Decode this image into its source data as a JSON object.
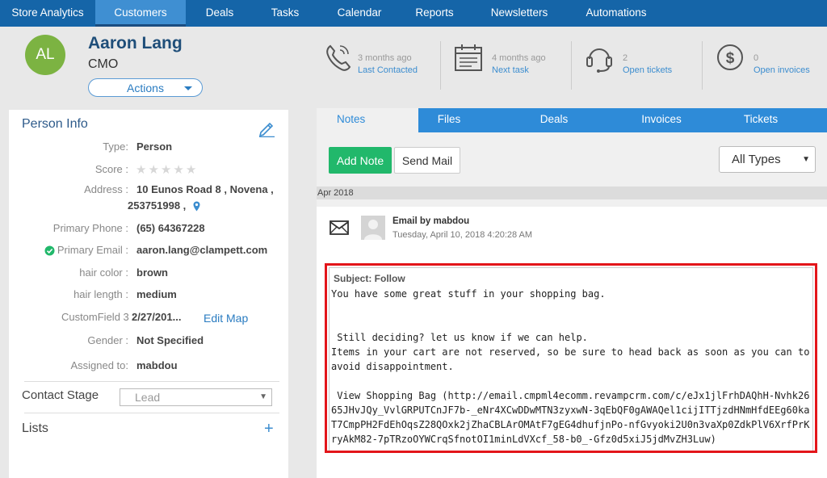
{
  "nav": {
    "items": [
      {
        "label": "Store Analytics",
        "width": 118
      },
      {
        "label": "Customers",
        "width": 112,
        "active": true
      },
      {
        "label": "Deals",
        "width": 84
      },
      {
        "label": "Tasks",
        "width": 78
      },
      {
        "label": "Calendar",
        "width": 106
      },
      {
        "label": "Reports",
        "width": 80
      },
      {
        "label": "Newsletters",
        "width": 130
      },
      {
        "label": "Automations",
        "width": 110
      }
    ]
  },
  "contact": {
    "initials": "AL",
    "name": "Aaron Lang",
    "title": "CMO",
    "actions_label": "Actions"
  },
  "stats": [
    {
      "top": "3 months ago",
      "bottom": "Last Contacted",
      "icon": "phone-icon"
    },
    {
      "top": "4 months ago",
      "bottom": "Next task",
      "icon": "calendar-icon"
    },
    {
      "top": "2",
      "bottom": "Open tickets",
      "icon": "headset-icon"
    },
    {
      "top": "0",
      "bottom": "Open invoices",
      "icon": "dollar-icon"
    }
  ],
  "person_info": {
    "title": "Person Info",
    "type_label": "Type:",
    "type_value": "Person",
    "score_label": "Score :",
    "address_label": "Address :",
    "address_line1": "10 Eunos Road 8 , Novena ,",
    "address_line2": "253751998 ,",
    "phone_label": "Primary Phone :",
    "phone_value": "(65) 64367228",
    "email_label": "Primary Email :",
    "email_value": "aaron.lang@clampett.com",
    "hair_color_label": "hair color :",
    "hair_color_value": "brown",
    "hair_length_label": "hair length :",
    "hair_length_value": "medium",
    "custom_label": "CustomField 3 :",
    "custom_value": "2/27/201...",
    "edit_map": "Edit Map",
    "gender_label": "Gender :",
    "gender_value": "Not Specified",
    "assigned_label": "Assigned to:",
    "assigned_value": "mabdou",
    "contact_stage_label": "Contact Stage",
    "contact_stage_value": "Lead",
    "lists_label": "Lists",
    "lists_plus": "+"
  },
  "tabs": {
    "items": [
      {
        "label": "Notes",
        "width": 126,
        "active": true
      },
      {
        "label": "Files",
        "width": 76
      },
      {
        "label": "Deals",
        "width": 184
      },
      {
        "label": "Invoices",
        "width": 82
      },
      {
        "label": "Tickets",
        "width": 164
      }
    ]
  },
  "notes": {
    "add_note": "Add Note",
    "send_mail": "Send Mail",
    "filter_value": "All Types",
    "date_group": "Apr 2018",
    "note_from": "Email by mabdou",
    "note_date": "Tuesday, April 10, 2018 4:20:28 AM",
    "subject": "Subject: Follow",
    "body_lines": [
      "You have some great stuff in your shopping bag.",
      "",
      "",
      " Still deciding? let us know if we can help.",
      "Items in your cart are not reserved, so be sure to head back as soon as you can to avoid disappointment.",
      "",
      " View Shopping Bag (http://email.cmpml4ecomm.revampcrm.com/c/eJx1jlFrhDAQhH-Nvhk2665JHvJQy_VvlGRPUTCnJF7b-_eNr4XCwDDwMTN3zyxwN-3qEbQF0gAWAQel1cijITTjzdHNmHfdEEg60kaT7CmpPH2FdEhOqsZ28QOxk2jZhaCBLArOMAtF7gEG4dhufjnPo-nfGvyoki2U0n3vaXp0ZdkPlV6XrfPrKryAkM82-7pTRzoOYWCrqSfnotOI1minLdVXcf_58-b0_-Gfz0d5xiJ5jdMvZH3Luw)"
    ]
  }
}
